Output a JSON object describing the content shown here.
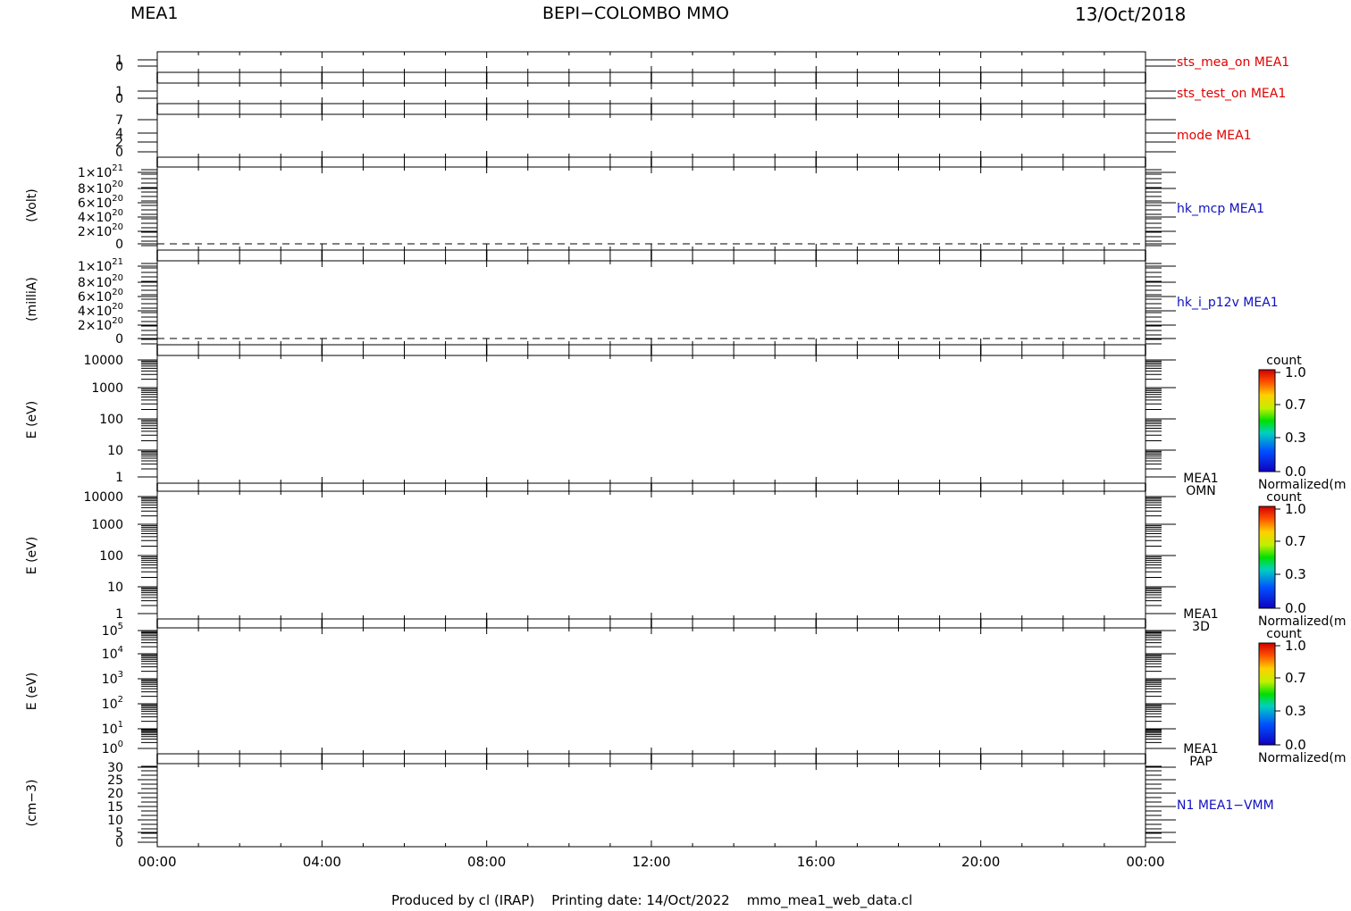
{
  "header": {
    "instrument": "MEA1",
    "mission": "BEPI−COLOMBO MMO",
    "date": "13/Oct/2018"
  },
  "footer": {
    "text": "Produced by cl (IRAP)    Printing date: 14/Oct/2022    mmo_mea1_web_data.cl"
  },
  "colors": {
    "red_label": "#e00000",
    "blue_label": "#1010c0",
    "axis": "#000000"
  },
  "chart_data": [
    {
      "type": "line",
      "name": "sts_mea_on",
      "label": "sts_mea_on MEA1",
      "label_color": "red",
      "ylabel": "",
      "yticks": [
        "1",
        "0"
      ],
      "ylim": [
        0,
        1
      ],
      "series": []
    },
    {
      "type": "line",
      "name": "sts_test_on",
      "label": "sts_test_on MEA1",
      "label_color": "red",
      "ylabel": "",
      "yticks": [
        "1",
        "0"
      ],
      "ylim": [
        0,
        1
      ],
      "series": []
    },
    {
      "type": "line",
      "name": "mode",
      "label": "mode MEA1",
      "label_color": "red",
      "ylabel": "",
      "yticks": [
        "7",
        "4",
        "2",
        "0"
      ],
      "ylim": [
        0,
        7
      ],
      "series": []
    },
    {
      "type": "line",
      "name": "hk_mcp",
      "label": "hk_mcp MEA1",
      "label_color": "blue",
      "ylabel": "(Volt)",
      "yticks": [
        {
          "m": "1",
          "e": "21"
        },
        {
          "m": "8",
          "e": "20"
        },
        {
          "m": "6",
          "e": "20"
        },
        {
          "m": "4",
          "e": "20"
        },
        {
          "m": "2",
          "e": "20"
        },
        {
          "m": "0",
          "e": ""
        }
      ],
      "ylim": [
        0,
        1e+21
      ],
      "series": [
        {
          "style": "dashed",
          "x": [
            "00:00",
            "24:00"
          ],
          "y": [
            0,
            0
          ]
        }
      ]
    },
    {
      "type": "line",
      "name": "hk_i_p12v",
      "label": "hk_i_p12v MEA1",
      "label_color": "blue",
      "ylabel": "(milliA)",
      "yticks": [
        {
          "m": "1",
          "e": "21"
        },
        {
          "m": "8",
          "e": "20"
        },
        {
          "m": "6",
          "e": "20"
        },
        {
          "m": "4",
          "e": "20"
        },
        {
          "m": "2",
          "e": "20"
        },
        {
          "m": "0",
          "e": ""
        }
      ],
      "ylim": [
        0,
        1e+21
      ],
      "series": [
        {
          "style": "dashed",
          "x": [
            "00:00",
            "24:00"
          ],
          "y": [
            0,
            0
          ]
        }
      ]
    },
    {
      "type": "heatmap",
      "name": "omn",
      "label": [
        "MEA1",
        "OMN"
      ],
      "ylabel": "E (eV)",
      "yscale": "log",
      "yticks": [
        "10000",
        "1000",
        "100",
        "10",
        "1"
      ],
      "ylim": [
        1,
        10000
      ],
      "colorbar": {
        "title": "count",
        "ticks": [
          "1.0",
          "0.7",
          "0.3",
          "0.0"
        ],
        "unit": "Normalized(m"
      },
      "values": []
    },
    {
      "type": "heatmap",
      "name": "3d",
      "label": [
        "MEA1",
        "3D"
      ],
      "ylabel": "E (eV)",
      "yscale": "log",
      "yticks": [
        "10000",
        "1000",
        "100",
        "10",
        "1"
      ],
      "ylim": [
        1,
        10000
      ],
      "colorbar": {
        "title": "count",
        "ticks": [
          "1.0",
          "0.7",
          "0.3",
          "0.0"
        ],
        "unit": "Normalized(m"
      },
      "values": []
    },
    {
      "type": "heatmap",
      "name": "pap",
      "label": [
        "MEA1",
        "PAP"
      ],
      "ylabel": "E (eV)",
      "yscale": "log",
      "yticks": [
        {
          "m": "10",
          "e": "5"
        },
        {
          "m": "10",
          "e": "4"
        },
        {
          "m": "10",
          "e": "3"
        },
        {
          "m": "10",
          "e": "2"
        },
        {
          "m": "10",
          "e": "1"
        },
        {
          "m": "10",
          "e": "0"
        }
      ],
      "ylim": [
        1,
        100000
      ],
      "colorbar": {
        "title": "count",
        "ticks": [
          "1.0",
          "0.7",
          "0.3",
          "0.0"
        ],
        "unit": "Normalized(m"
      },
      "values": []
    },
    {
      "type": "line",
      "name": "n1",
      "label": "N1 MEA1−VMM",
      "label_color": "blue",
      "ylabel": "(cm−3)",
      "yticks": [
        "30",
        "25",
        "20",
        "15",
        "10",
        "5",
        "0"
      ],
      "ylim": [
        0,
        30
      ],
      "series": []
    }
  ],
  "xaxis": {
    "ticks": [
      "00:00",
      "04:00",
      "08:00",
      "12:00",
      "16:00",
      "20:00",
      "00:00"
    ],
    "xlim": [
      "00:00",
      "24:00"
    ]
  }
}
